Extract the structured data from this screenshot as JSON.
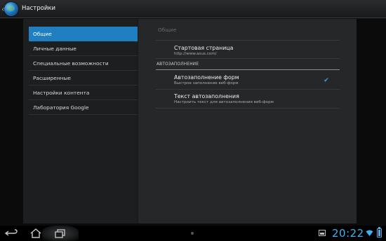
{
  "actionbar": {
    "title": "Настройки"
  },
  "headers": {
    "items": [
      {
        "label": "Общие",
        "selected": true
      },
      {
        "label": "Личные данные",
        "selected": false
      },
      {
        "label": "Специальные возможности",
        "selected": false
      },
      {
        "label": "Расширенные",
        "selected": false
      },
      {
        "label": "Настройки контента",
        "selected": false
      },
      {
        "label": "Лаборатория Google",
        "selected": false
      }
    ]
  },
  "pane": {
    "title": "Общие",
    "home_page": {
      "title": "Стартовая страница",
      "summary": "http://www.asus.com/"
    },
    "autofill_category": "АВТОЗАПОЛНЕНИЕ",
    "form_autofill": {
      "title": "Автозаполнение форм",
      "summary": "Быстрое заполнение веб-форм",
      "checked": true
    },
    "autofill_text": {
      "title": "Текст автозаполнения",
      "summary": "Настроить текст для автозаполнения веб-форм"
    }
  },
  "statusbar": {
    "time": "20:22"
  },
  "colors": {
    "accent": "#1f7fc1",
    "clock": "#3fb3ef"
  }
}
